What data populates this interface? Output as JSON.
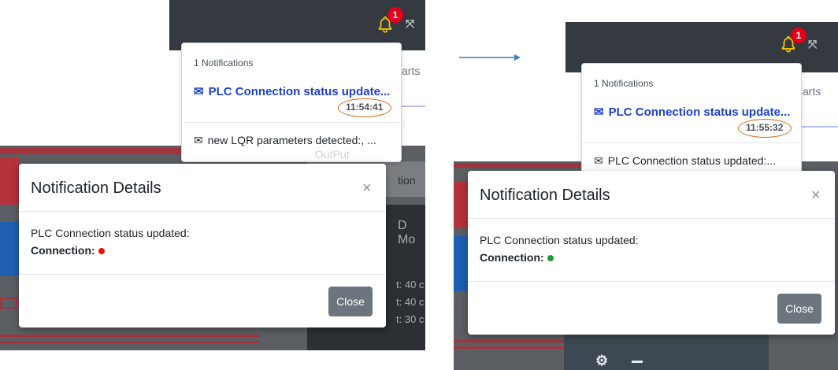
{
  "arrow": {
    "color": "#3b7fc6"
  },
  "left": {
    "badge_count": "1",
    "bell_color": "#f2c200",
    "behind_text_1": "arts",
    "behind_text_2": "tion",
    "behind_text_3": "D Mo",
    "behind_text_4": "t: 40 c",
    "behind_text_5": "t: 40 c",
    "behind_text_6": "t: 30 c",
    "behind_text_7": "OutPut",
    "dropdown": {
      "header": "1 Notifications",
      "title": "PLC Connection status update...",
      "time": "11:54:41",
      "second_item": "new LQR parameters detected:, ..."
    },
    "modal": {
      "title": "Notification Details",
      "close_x": "×",
      "message": "PLC Connection status updated:",
      "connection_label": "Connection:",
      "connection_color": "#e81010",
      "close_button": "Close"
    }
  },
  "right": {
    "badge_count": "1",
    "bell_color": "#f2c200",
    "behind_text_1": "arts",
    "dropdown": {
      "header": "1 Notifications",
      "title": "PLC Connection status update...",
      "time": "11:55:32",
      "second_item": "PLC Connection status updated:..."
    },
    "modal": {
      "title": "Notification Details",
      "close_x": "×",
      "message": "PLC Connection status updated:",
      "connection_label": "Connection:",
      "connection_color": "#1e9a3a",
      "close_button": "Close"
    }
  }
}
